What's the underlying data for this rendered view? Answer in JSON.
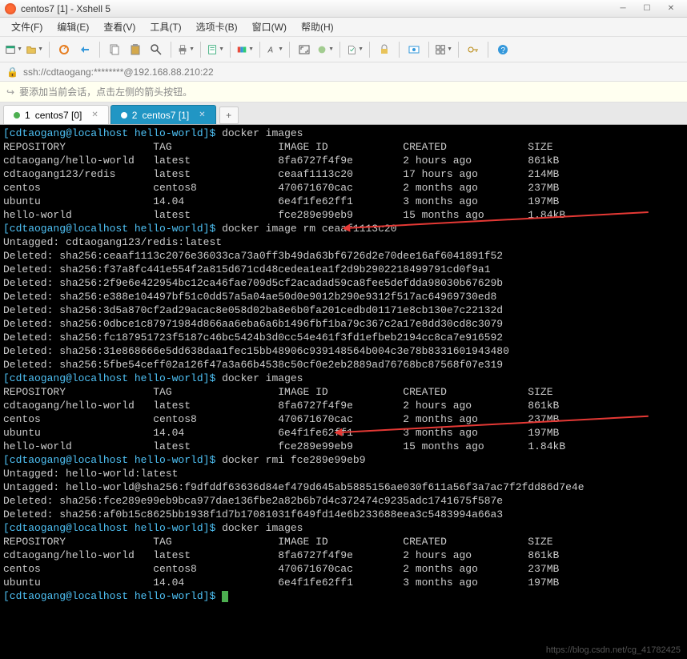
{
  "window": {
    "title": "centos7 [1] - Xshell 5"
  },
  "menu": {
    "file": "文件(F)",
    "edit": "编辑(E)",
    "view": "查看(V)",
    "tools": "工具(T)",
    "tab": "选项卡(B)",
    "window": "窗口(W)",
    "help": "帮助(H)"
  },
  "address": {
    "text": "ssh://cdtaogang:********@192.168.88.210:22"
  },
  "infobar": {
    "text": "要添加当前会话，点击左侧的箭头按钮。"
  },
  "tabs": [
    {
      "index": "1",
      "name": "centos7 [0]",
      "active": false
    },
    {
      "index": "2",
      "name": "centos7 [1]",
      "active": true
    }
  ],
  "terminal": {
    "prompt_user": "[cdtaogang@localhost ",
    "prompt_folder": "hello-world",
    "prompt_end": "]$ ",
    "cmd1": "docker images",
    "header": {
      "repo": "REPOSITORY",
      "tag": "TAG",
      "imageid": "IMAGE ID",
      "created": "CREATED",
      "size": "SIZE"
    },
    "list1": [
      {
        "repo": "cdtaogang/hello-world",
        "tag": "latest",
        "id": "8fa6727f4f9e",
        "created": "2 hours ago",
        "size": "861kB"
      },
      {
        "repo": "cdtaogang123/redis",
        "tag": "latest",
        "id": "ceaaf1113c20",
        "created": "17 hours ago",
        "size": "214MB"
      },
      {
        "repo": "centos",
        "tag": "centos8",
        "id": "470671670cac",
        "created": "2 months ago",
        "size": "237MB"
      },
      {
        "repo": "ubuntu",
        "tag": "14.04",
        "id": "6e4f1fe62ff1",
        "created": "3 months ago",
        "size": "197MB"
      },
      {
        "repo": "hello-world",
        "tag": "latest",
        "id": "fce289e99eb9",
        "created": "15 months ago",
        "size": "1.84kB"
      }
    ],
    "cmd2": "docker image rm ceaaf1113c20",
    "untagged1": "Untagged: cdtaogang123/redis:latest",
    "deleted1": [
      "Deleted: sha256:ceaaf1113c2076e36033ca73a0ff3b49da63bf6726d2e70dee16af6041891f52",
      "Deleted: sha256:f37a8fc441e554f2a815d671cd48cedea1ea1f2d9b2902218499791cd0f9a1",
      "Deleted: sha256:2f9e6e422954bc12ca46fae709d5cf2acadad59ca8fee5defdda98030b67629b",
      "Deleted: sha256:e388e104497bf51c0dd57a5a04ae50d0e9012b290e9312f517ac64969730ed8",
      "Deleted: sha256:3d5a870cf2ad29acac8e058d02ba8e6b0fa201cedbd01171e8cb130e7c22132d",
      "Deleted: sha256:0dbce1c87971984d866aa6eba6a6b1496fbf1ba79c367c2a17e8dd30cd8c3079",
      "Deleted: sha256:fc187951723f5187c46bc5424b3d0cc54e461f3fd1efbeb2194cc8ca7e916592",
      "Deleted: sha256:31e868666e5dd638daa1fec15bb48906c939148564b004c3e78b8331601943480",
      "Deleted: sha256:5fbe54ceff02a126f47a3a66b4538c50cf0e2eb2889ad76768bc87568f07e319"
    ],
    "cmd3": "docker images",
    "list2": [
      {
        "repo": "cdtaogang/hello-world",
        "tag": "latest",
        "id": "8fa6727f4f9e",
        "created": "2 hours ago",
        "size": "861kB"
      },
      {
        "repo": "centos",
        "tag": "centos8",
        "id": "470671670cac",
        "created": "2 months ago",
        "size": "237MB"
      },
      {
        "repo": "ubuntu",
        "tag": "14.04",
        "id": "6e4f1fe62ff1",
        "created": "3 months ago",
        "size": "197MB"
      },
      {
        "repo": "hello-world",
        "tag": "latest",
        "id": "fce289e99eb9",
        "created": "15 months ago",
        "size": "1.84kB"
      }
    ],
    "cmd4": "docker rmi fce289e99eb9",
    "untagged2a": "Untagged: hello-world:latest",
    "untagged2b": "Untagged: hello-world@sha256:f9dfddf63636d84ef479d645ab5885156ae030f611a56f3a7ac7f2fdd86d7e4e",
    "deleted2": [
      "Deleted: sha256:fce289e99eb9bca977dae136fbe2a82b6b7d4c372474c9235adc1741675f587e",
      "Deleted: sha256:af0b15c8625bb1938f1d7b17081031f649fd14e6b233688eea3c5483994a66a3"
    ],
    "cmd5": "docker images",
    "list3": [
      {
        "repo": "cdtaogang/hello-world",
        "tag": "latest",
        "id": "8fa6727f4f9e",
        "created": "2 hours ago",
        "size": "861kB"
      },
      {
        "repo": "centos",
        "tag": "centos8",
        "id": "470671670cac",
        "created": "2 months ago",
        "size": "237MB"
      },
      {
        "repo": "ubuntu",
        "tag": "14.04",
        "id": "6e4f1fe62ff1",
        "created": "3 months ago",
        "size": "197MB"
      }
    ]
  },
  "watermark": "https://blog.csdn.net/cg_41782425"
}
